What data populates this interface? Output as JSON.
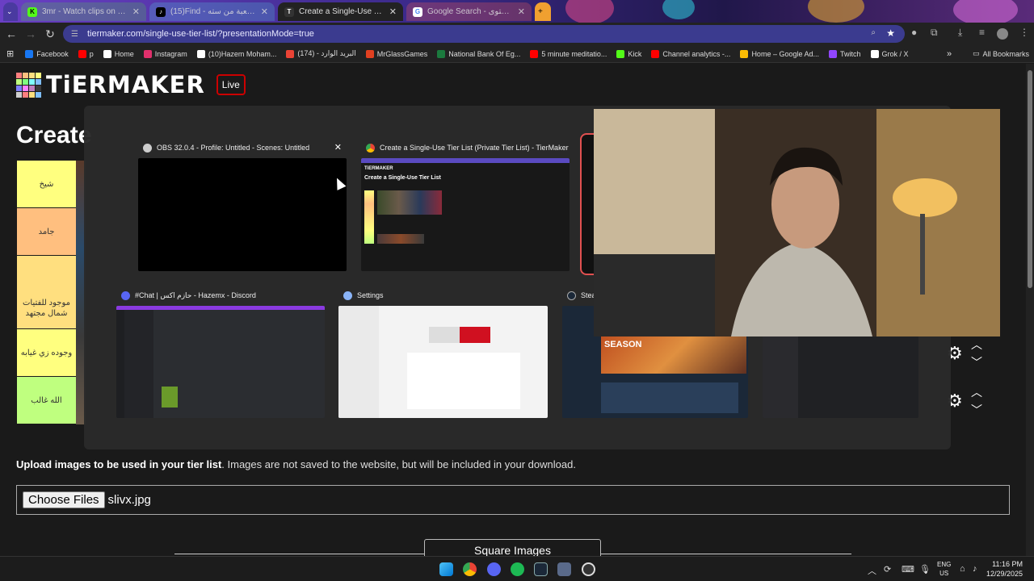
{
  "browser": {
    "tabs": [
      {
        "label": "3mr - Watch clips on Kick",
        "icon": "kick-icon"
      },
      {
        "label": "(15)Find - تكيش اللعبة من سته",
        "icon": "tiktok-icon"
      },
      {
        "label": "Create a Single-Use Tier List (P...",
        "icon": "tiermaker-icon"
      },
      {
        "label": "Google Search - المحتوى",
        "icon": "google-icon"
      }
    ],
    "url": "tiermaker.com/single-use-tier-list/?presentationMode=true",
    "bookmarks": [
      {
        "label": "Facebook",
        "color": "#1877f2"
      },
      {
        "label": "p",
        "color": "#ff0000"
      },
      {
        "label": "Home",
        "color": "#ffffff"
      },
      {
        "label": "Instagram",
        "color": "#e1306c"
      },
      {
        "label": "(10)Hazem Moham...",
        "color": "#ffffff"
      },
      {
        "label": "(174) - البريد الوارد",
        "color": "#ea4335"
      },
      {
        "label": "MrGlassGames",
        "color": "#e04020"
      },
      {
        "label": "National Bank Of Eg...",
        "color": "#1b7a3e"
      },
      {
        "label": "5 minute meditatio...",
        "color": "#ff0000"
      },
      {
        "label": "Kick",
        "color": "#53fc18"
      },
      {
        "label": "Channel analytics -...",
        "color": "#ff0000"
      },
      {
        "label": "Home – Google Ad...",
        "color": "#fbbc04"
      },
      {
        "label": "Twitch",
        "color": "#9146ff"
      },
      {
        "label": "Grok / X",
        "color": "#ffffff"
      }
    ],
    "all_bookmarks": "All Bookmarks"
  },
  "page": {
    "logo": "TiERMAKER",
    "live": "Live",
    "title": "Create",
    "tiers": [
      {
        "label": "شيخ",
        "color": "#ffff7f"
      },
      {
        "label": "جامد",
        "color": "#ffbf7f"
      },
      {
        "label": "موجود للفتيات شمال مجتهد",
        "color": "#ffdf7f"
      },
      {
        "label": "وجوده زي غيابه",
        "color": "#ffff7f"
      },
      {
        "label": "الله غالب",
        "color": "#bfff7f"
      }
    ],
    "upload_bold": "Upload images to be used in your tier list",
    "upload_rest": ". Images are not saved to the website, but will be included in your download.",
    "choose_files": "Choose Files",
    "file_name": "slivx.jpg",
    "square_images": "Square Images"
  },
  "switcher": {
    "windows": [
      {
        "title": "OBS 32.0.4 - Profile: Untitled - Scenes: Untitled"
      },
      {
        "title": "Create a Single-Use Tier List (Private Tier List) - TierMaker - G..."
      },
      {
        "title": "#Chat | حازم اكس - Hazemx - Discord"
      },
      {
        "title": "Settings"
      },
      {
        "title": "Steam"
      }
    ],
    "thumb_text": "Create a Single-Use Tier List",
    "steam_text": "SEASON"
  },
  "taskbar": {
    "lang1": "ENG",
    "lang2": "US",
    "time": "11:16 PM",
    "date": "12/29/2025"
  }
}
